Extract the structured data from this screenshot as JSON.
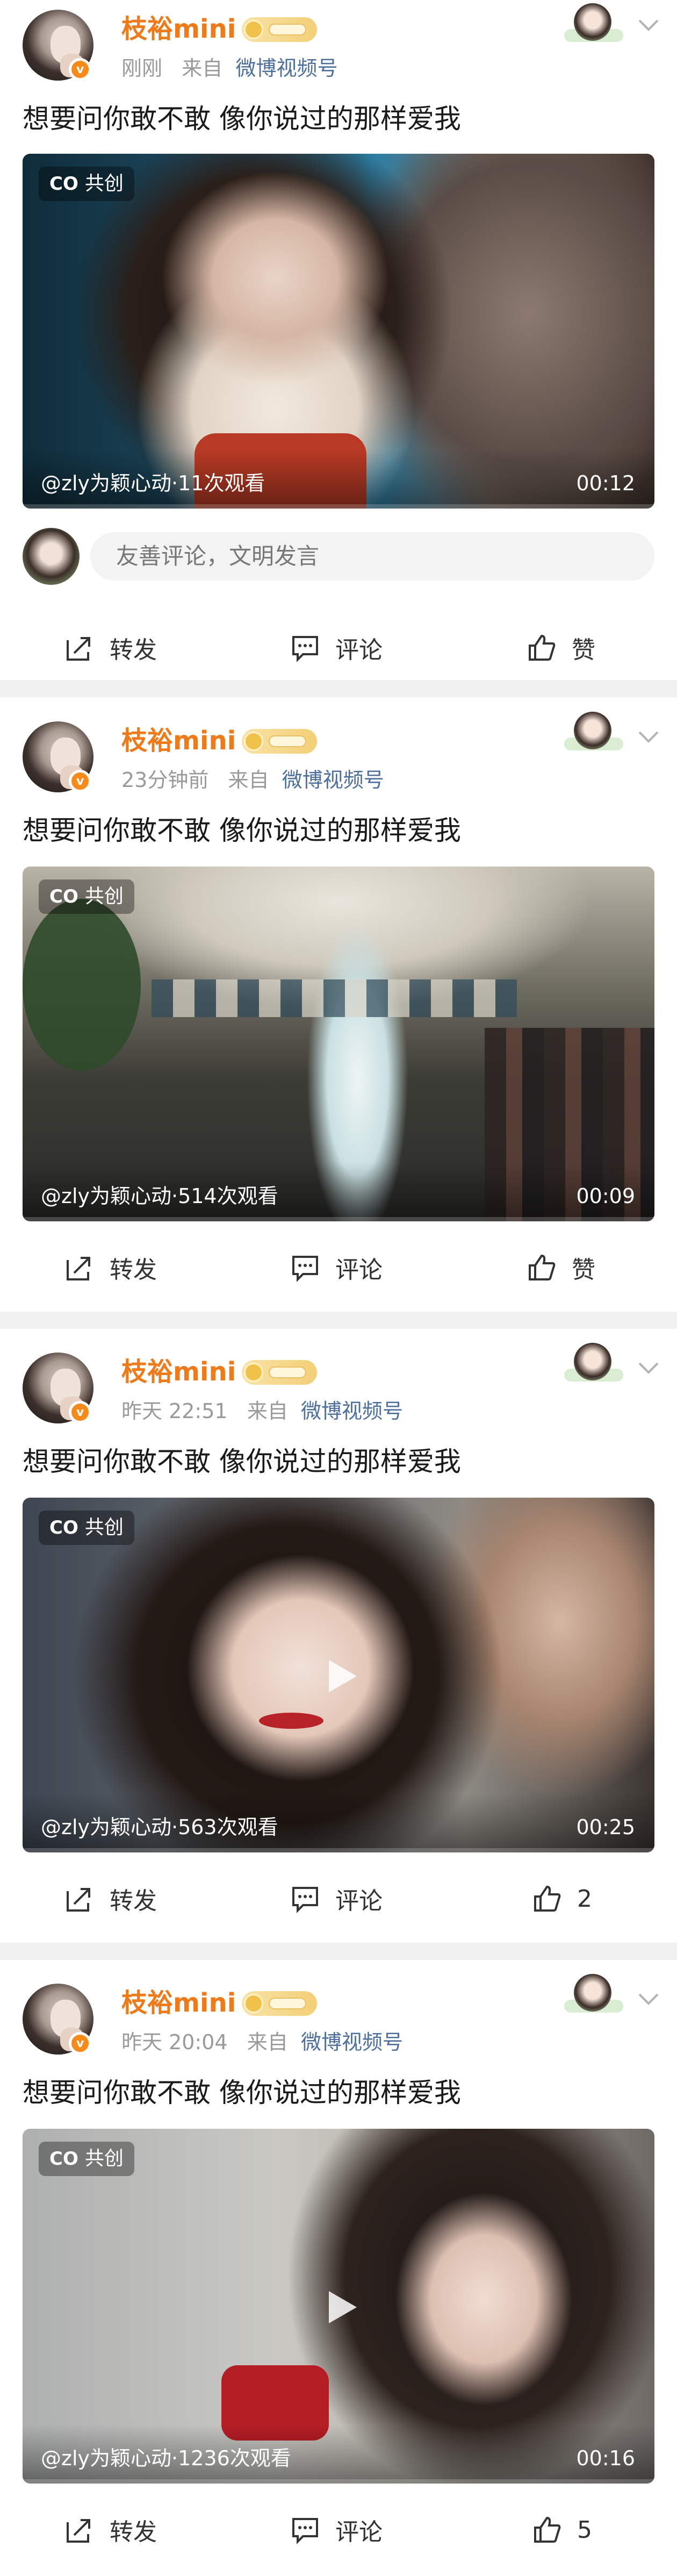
{
  "posts": [
    {
      "username": "枝裕mini",
      "time": "刚刚",
      "source_prefix": "来自",
      "source": "微博视频号",
      "text": "想要问你敢不敢 像你说过的那样爱我",
      "video": {
        "badge": "共创",
        "info": "@zly为颖心动·11次观看",
        "duration": "00:12"
      },
      "comment_placeholder": "友善评论，文明发言",
      "actions": {
        "repost": "转发",
        "comment": "评论",
        "like": "赞"
      }
    },
    {
      "username": "枝裕mini",
      "time": "23分钟前",
      "source_prefix": "来自",
      "source": "微博视频号",
      "text": "想要问你敢不敢 像你说过的那样爱我",
      "video": {
        "badge": "共创",
        "info": "@zly为颖心动·514次观看",
        "duration": "00:09"
      },
      "actions": {
        "repost": "转发",
        "comment": "评论",
        "like": "赞"
      }
    },
    {
      "username": "枝裕mini",
      "time": "昨天 22:51",
      "source_prefix": "来自",
      "source": "微博视频号",
      "text": "想要问你敢不敢 像你说过的那样爱我",
      "video": {
        "badge": "共创",
        "info": "@zly为颖心动·563次观看",
        "duration": "00:25"
      },
      "actions": {
        "repost": "转发",
        "comment": "评论",
        "like": "2"
      }
    },
    {
      "username": "枝裕mini",
      "time": "昨天 20:04",
      "source_prefix": "来自",
      "source": "微博视频号",
      "text": "想要问你敢不敢 像你说过的那样爱我",
      "video": {
        "badge": "共创",
        "info": "@zly为颖心动·1236次观看",
        "duration": "00:16"
      },
      "actions": {
        "repost": "转发",
        "comment": "评论",
        "like": "5"
      }
    }
  ],
  "icons": {
    "verified": "v-badge-icon",
    "rank": "crown-rank-icon",
    "more": "chevron-down-icon",
    "repost": "share-arrow-icon",
    "comment": "comment-bubble-icon",
    "like": "thumbs-up-icon",
    "play": "play-icon"
  },
  "colors": {
    "username": "#ef7a1a",
    "source_link": "#4d6f9e",
    "separator": "#f0f0f0"
  }
}
